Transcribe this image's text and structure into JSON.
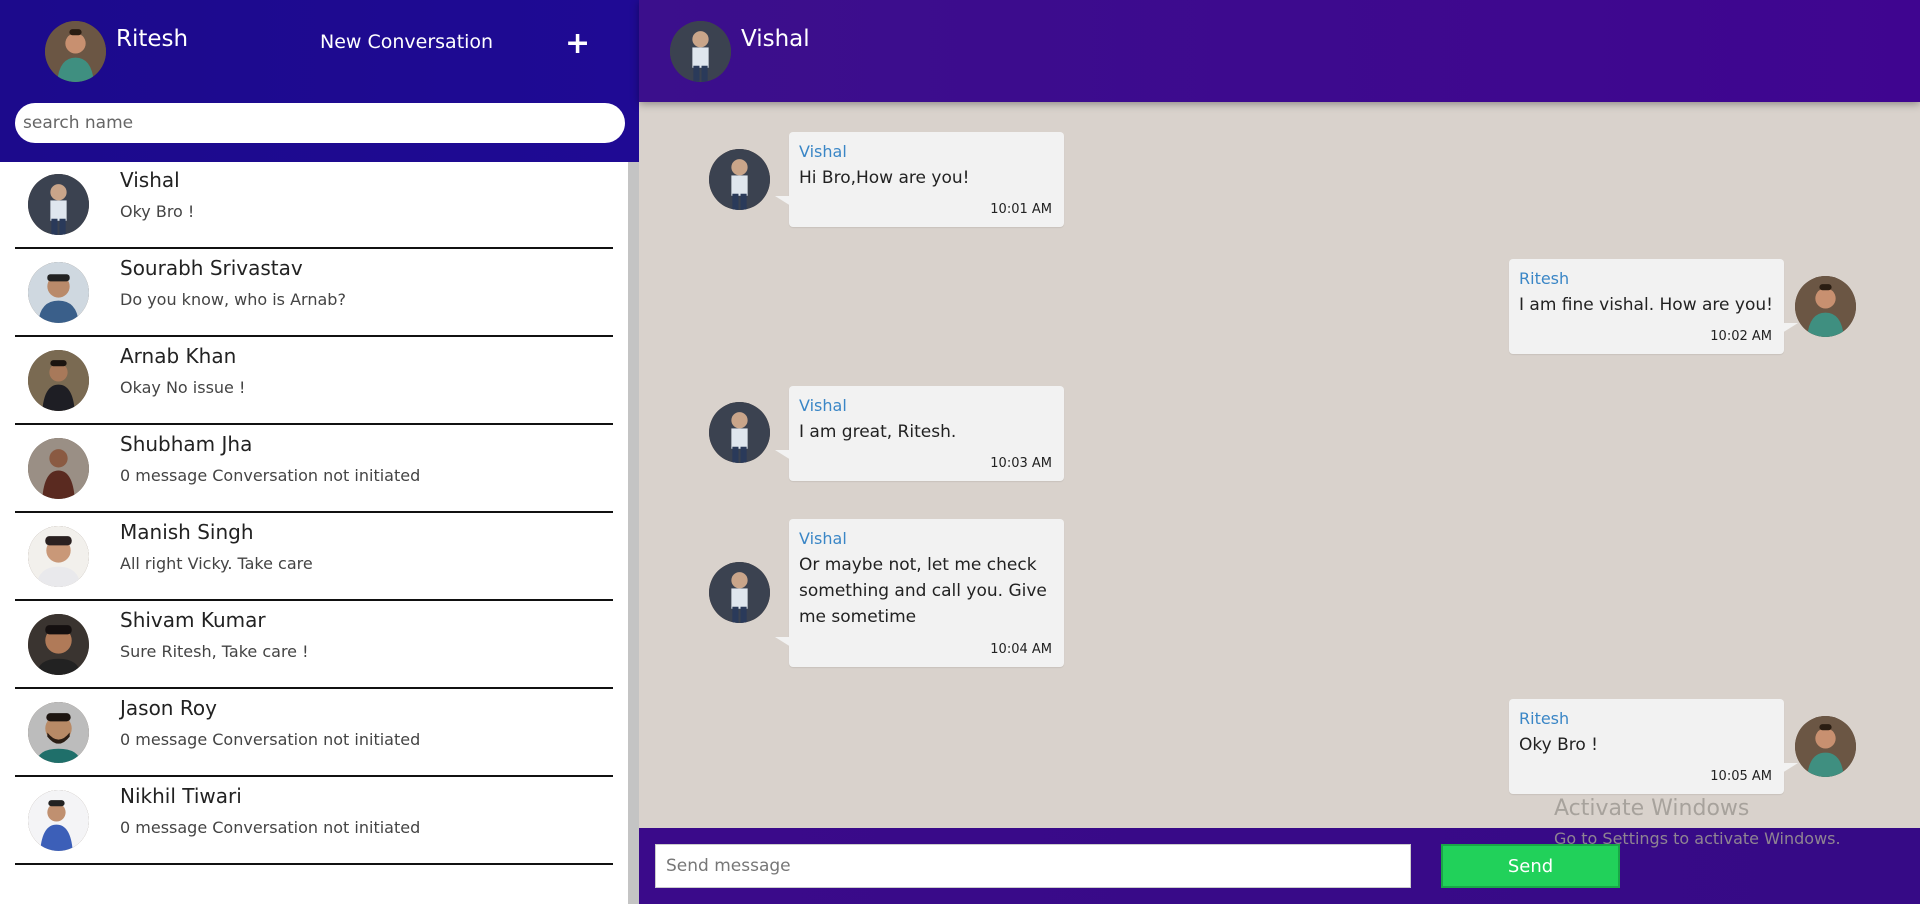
{
  "current_user": {
    "name": "Ritesh"
  },
  "sidebar": {
    "new_conversation_label": "New Conversation",
    "add_icon": "+",
    "search_placeholder": "search name",
    "contacts": [
      {
        "name": "Vishal",
        "last_message": "Oky Bro !"
      },
      {
        "name": "Sourabh Srivastav",
        "last_message": "Do you know, who is Arnab?"
      },
      {
        "name": "Arnab Khan",
        "last_message": "Okay No issue !"
      },
      {
        "name": "Shubham Jha",
        "last_message": "0 message Conversation not initiated"
      },
      {
        "name": "Manish Singh",
        "last_message": "All right Vicky. Take care"
      },
      {
        "name": "Shivam Kumar",
        "last_message": "Sure Ritesh, Take care !"
      },
      {
        "name": "Jason Roy",
        "last_message": "0 message Conversation not initiated"
      },
      {
        "name": "Nikhil Tiwari",
        "last_message": "0 message Conversation not initiated"
      }
    ]
  },
  "chat": {
    "peer_name": "Vishal",
    "messages": [
      {
        "sender": "Vishal",
        "text": "Hi Bro,How are you!",
        "time": "10:01 AM"
      },
      {
        "sender": "Ritesh",
        "text": "I am fine vishal. How are you!",
        "time": "10:02 AM"
      },
      {
        "sender": "Vishal",
        "text": "I am great, Ritesh.",
        "time": "10:03 AM"
      },
      {
        "sender": "Vishal",
        "text": "Or maybe not, let me check something and call you. Give me sometime",
        "time": "10:04 AM"
      },
      {
        "sender": "Ritesh",
        "text": "Oky Bro !",
        "time": "10:05 AM"
      }
    ],
    "input_placeholder": "Send message",
    "send_label": "Send"
  },
  "watermark": {
    "title": "Activate Windows",
    "subtitle": "Go to Settings to activate Windows."
  },
  "colors": {
    "left_header": "#1c0a8c",
    "right_header": "#3f0590",
    "chat_background": "#d9d2cc",
    "sender_name": "#3a86c6",
    "send_button": "#21d15a"
  }
}
